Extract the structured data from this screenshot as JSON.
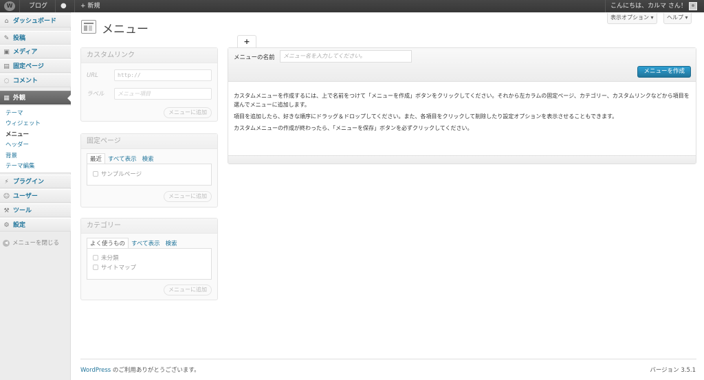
{
  "adminbar": {
    "blog": "ブログ",
    "comments_icon": "speech-bubble-icon",
    "new": "+ 新規",
    "greeting": "こんにちは、カルマ さん！"
  },
  "screen_options": {
    "options": "表示オプション ▾",
    "help": "ヘルプ ▾"
  },
  "sidebar": {
    "items": [
      {
        "label": "ダッシュボード",
        "icon": "⌂"
      },
      {
        "label": "投稿",
        "icon": "✎"
      },
      {
        "label": "メディア",
        "icon": "▣"
      },
      {
        "label": "固定ページ",
        "icon": "▤"
      },
      {
        "label": "コメント",
        "icon": "◌"
      },
      {
        "label": "外観",
        "icon": "▦"
      },
      {
        "label": "プラグイン",
        "icon": "⚡"
      },
      {
        "label": "ユーザー",
        "icon": "☺"
      },
      {
        "label": "ツール",
        "icon": "⚒"
      },
      {
        "label": "設定",
        "icon": "⚙"
      }
    ],
    "submenu": [
      "テーマ",
      "ウィジェット",
      "メニュー",
      "ヘッダー",
      "背景",
      "テーマ編集"
    ],
    "collapse": "メニューを閉じる"
  },
  "page": {
    "title": "メニュー"
  },
  "custom_links": {
    "title": "カスタムリンク",
    "url_label": "URL",
    "url_value": "http://",
    "label_label": "ラベル",
    "label_placeholder": "メニュー項目",
    "add_button": "メニューに追加"
  },
  "pages_box": {
    "title": "固定ページ",
    "tabs": [
      "最近",
      "すべて表示",
      "検索"
    ],
    "items": [
      "サンプルページ"
    ],
    "add_button": "メニューに追加"
  },
  "categories_box": {
    "title": "カテゴリー",
    "tabs": [
      "よく使うもの",
      "すべて表示",
      "検索"
    ],
    "items": [
      "未分類",
      "サイトマップ"
    ],
    "add_button": "メニューに追加"
  },
  "menu_panel": {
    "plus_tab": "+",
    "name_label": "メニューの名前",
    "name_placeholder": "メニュー名を入力してください。",
    "create_button": "メニューを作成",
    "paragraphs": [
      "カスタムメニューを作成するには、上で名前をつけて「メニューを作成」ボタンをクリックしてください。それから左カラムの固定ページ、カテゴリー、カスタムリンクなどから項目を選んでメニューに追加します。",
      "項目を追加したら、好きな順序にドラッグ＆ドロップしてください。また、各項目をクリックして削除したり設定オプションを表示させることもできます。",
      "カスタムメニューの作成が終わったら、「メニューを保存」ボタンを必ずクリックしてください。"
    ]
  },
  "footer": {
    "wp_link": "WordPress",
    "thanks": " のご利用ありがとうございます。",
    "version": "バージョン 3.5.1"
  }
}
